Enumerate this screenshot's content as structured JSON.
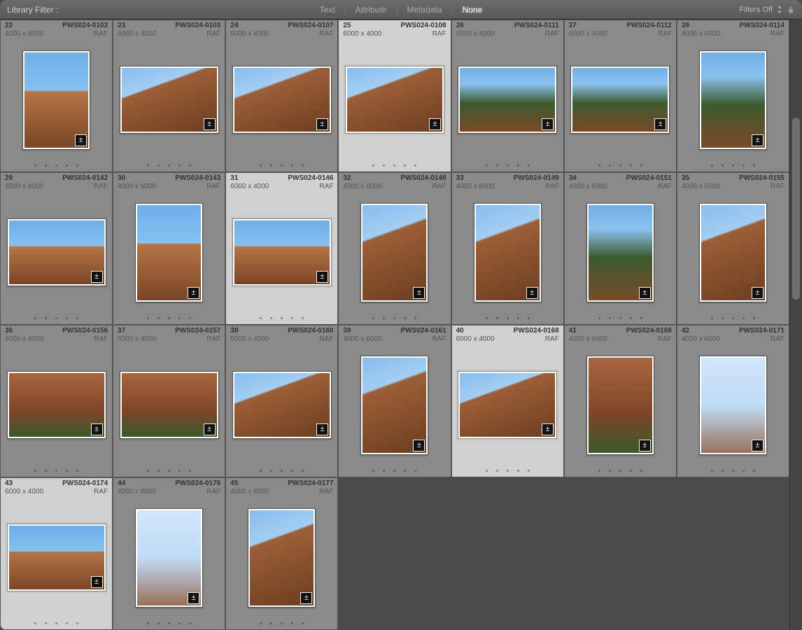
{
  "filterBar": {
    "title": "Library Filter :",
    "tabs": [
      "Text",
      "Attribute",
      "Metadata",
      "None"
    ],
    "activeTab": "None",
    "filtersOff": "Filters Off"
  },
  "thumbnails": [
    {
      "idx": "22",
      "fname": "PWS024-0102",
      "dims": "4000 x 6000",
      "fmt": "RAF",
      "orient": "portrait",
      "sel": false,
      "v": "v2"
    },
    {
      "idx": "23",
      "fname": "PWS024-0103",
      "dims": "6000 x 4000",
      "fmt": "RAF",
      "orient": "landscape",
      "sel": false,
      "v": "v3"
    },
    {
      "idx": "24",
      "fname": "PWS024-0107",
      "dims": "6000 x 4000",
      "fmt": "RAF",
      "orient": "landscape",
      "sel": false,
      "v": "v3"
    },
    {
      "idx": "25",
      "fname": "PWS024-0108",
      "dims": "6000 x 4000",
      "fmt": "RAF",
      "orient": "landscape",
      "sel": true,
      "v": "v3"
    },
    {
      "idx": "26",
      "fname": "PWS024-0111",
      "dims": "6000 x 4000",
      "fmt": "RAF",
      "orient": "landscape",
      "sel": false,
      "v": "v4"
    },
    {
      "idx": "27",
      "fname": "PWS024-0112",
      "dims": "6000 x 4000",
      "fmt": "RAF",
      "orient": "landscape",
      "sel": false,
      "v": "v4"
    },
    {
      "idx": "28",
      "fname": "PWS024-0114",
      "dims": "4000 x 6000",
      "fmt": "RAF",
      "orient": "portrait",
      "sel": false,
      "v": "v4"
    },
    {
      "idx": "29",
      "fname": "PWS024-0142",
      "dims": "6000 x 4000",
      "fmt": "RAF",
      "orient": "landscape",
      "sel": false,
      "v": "v2"
    },
    {
      "idx": "30",
      "fname": "PWS024-0143",
      "dims": "4000 x 6000",
      "fmt": "RAF",
      "orient": "portrait",
      "sel": false,
      "v": "v2"
    },
    {
      "idx": "31",
      "fname": "PWS024-0146",
      "dims": "6000 x 4000",
      "fmt": "RAF",
      "orient": "landscape",
      "sel": true,
      "v": "v2"
    },
    {
      "idx": "32",
      "fname": "PWS024-0148",
      "dims": "4000 x 6000",
      "fmt": "RAF",
      "orient": "portrait",
      "sel": false,
      "v": "v3"
    },
    {
      "idx": "33",
      "fname": "PWS024-0149",
      "dims": "4000 x 6000",
      "fmt": "RAF",
      "orient": "portrait",
      "sel": false,
      "v": "v3"
    },
    {
      "idx": "34",
      "fname": "PWS024-0151",
      "dims": "4000 x 6000",
      "fmt": "RAF",
      "orient": "portrait",
      "sel": false,
      "v": "v4"
    },
    {
      "idx": "35",
      "fname": "PWS024-0155",
      "dims": "4000 x 6000",
      "fmt": "RAF",
      "orient": "portrait",
      "sel": false,
      "v": "v3"
    },
    {
      "idx": "36",
      "fname": "PWS024-0156",
      "dims": "6000 x 4000",
      "fmt": "RAF",
      "orient": "landscape",
      "sel": false,
      "v": "v5"
    },
    {
      "idx": "37",
      "fname": "PWS024-0157",
      "dims": "6000 x 4000",
      "fmt": "RAF",
      "orient": "landscape",
      "sel": false,
      "v": "v5"
    },
    {
      "idx": "38",
      "fname": "PWS024-0160",
      "dims": "6000 x 4000",
      "fmt": "RAF",
      "orient": "landscape",
      "sel": false,
      "v": "v3"
    },
    {
      "idx": "39",
      "fname": "PWS024-0161",
      "dims": "4000 x 6000",
      "fmt": "RAF",
      "orient": "portrait",
      "sel": false,
      "v": "v3"
    },
    {
      "idx": "40",
      "fname": "PWS024-0168",
      "dims": "6000 x 4000",
      "fmt": "RAF",
      "orient": "landscape",
      "sel": true,
      "v": "v3"
    },
    {
      "idx": "41",
      "fname": "PWS024-0169",
      "dims": "4000 x 6000",
      "fmt": "RAF",
      "orient": "portrait",
      "sel": false,
      "v": "v5"
    },
    {
      "idx": "42",
      "fname": "PWS024-0171",
      "dims": "4000 x 6000",
      "fmt": "RAF",
      "orient": "portrait",
      "sel": false,
      "v": "v6"
    },
    {
      "idx": "43",
      "fname": "PWS024-0174",
      "dims": "6000 x 4000",
      "fmt": "RAF",
      "orient": "landscape",
      "sel": true,
      "v": "v2"
    },
    {
      "idx": "44",
      "fname": "PWS024-0176",
      "dims": "4000 x 6000",
      "fmt": "RAF",
      "orient": "portrait",
      "sel": false,
      "v": "v6"
    },
    {
      "idx": "45",
      "fname": "PWS024-0177",
      "dims": "4000 x 6000",
      "fmt": "RAF",
      "orient": "portrait",
      "sel": false,
      "v": "v3"
    }
  ],
  "gridCols": 7,
  "gridRows": 4
}
